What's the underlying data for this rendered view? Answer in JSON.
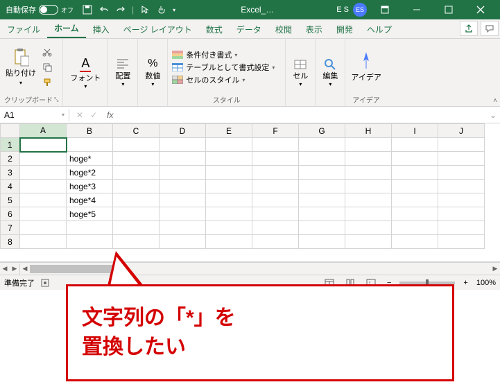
{
  "titlebar": {
    "autosave_label": "自動保存",
    "autosave_state": "オフ",
    "app_title": "Excel_…",
    "user_initials_text": "E S",
    "user_badge": "ES"
  },
  "tabs": {
    "file": "ファイル",
    "home": "ホーム",
    "insert": "挿入",
    "pagelayout": "ページ レイアウト",
    "formulas": "数式",
    "data": "データ",
    "review": "校閲",
    "view": "表示",
    "developer": "開発",
    "help": "ヘルプ"
  },
  "ribbon": {
    "clipboard": {
      "paste": "貼り付け",
      "label": "クリップボード"
    },
    "font": {
      "label": "フォント"
    },
    "alignment": {
      "label": "配置"
    },
    "number": {
      "label": "数値"
    },
    "styles": {
      "cond_format": "条件付き書式",
      "table_format": "テーブルとして書式設定",
      "cell_styles": "セルのスタイル",
      "label": "スタイル"
    },
    "cells": {
      "label": "セル"
    },
    "editing": {
      "label": "編集"
    },
    "ideas": {
      "btn": "アイデア",
      "label": "アイデア"
    }
  },
  "namebox": {
    "ref": "A1",
    "fx": "fx"
  },
  "columns": [
    "A",
    "B",
    "C",
    "D",
    "E",
    "F",
    "G",
    "H",
    "I",
    "J"
  ],
  "rows": [
    "1",
    "2",
    "3",
    "4",
    "5",
    "6",
    "7",
    "8"
  ],
  "cells": {
    "B2": "hoge*",
    "B3": "hoge*2",
    "B4": "hoge*3",
    "B5": "hoge*4",
    "B6": "hoge*5"
  },
  "status": {
    "ready": "準備完了",
    "zoom": "100%"
  },
  "callout": {
    "line1": "文字列の「*」を",
    "line2": "置換したい"
  }
}
